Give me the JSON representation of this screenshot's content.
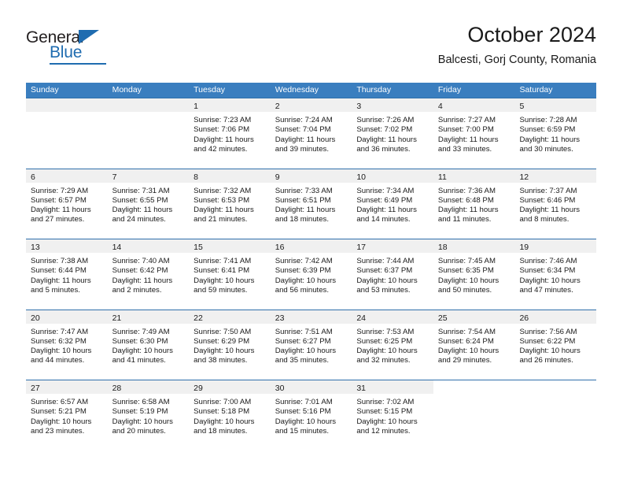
{
  "brand": {
    "name_part1": "General",
    "name_part2": "Blue",
    "accent_color": "#1f6cb0"
  },
  "header": {
    "title": "October 2024",
    "subtitle": "Balcesti, Gorj County, Romania"
  },
  "calendar": {
    "header_color": "#3a7ebf",
    "weekdays": [
      "Sunday",
      "Monday",
      "Tuesday",
      "Wednesday",
      "Thursday",
      "Friday",
      "Saturday"
    ],
    "labels": {
      "sunrise": "Sunrise:",
      "sunset": "Sunset:",
      "daylight": "Daylight:"
    },
    "weeks": [
      [
        {
          "day": "",
          "sunrise": "",
          "sunset": "",
          "daylight_line1": "",
          "daylight_line2": ""
        },
        {
          "day": "",
          "sunrise": "",
          "sunset": "",
          "daylight_line1": "",
          "daylight_line2": ""
        },
        {
          "day": "1",
          "sunrise": "Sunrise: 7:23 AM",
          "sunset": "Sunset: 7:06 PM",
          "daylight_line1": "Daylight: 11 hours",
          "daylight_line2": "and 42 minutes."
        },
        {
          "day": "2",
          "sunrise": "Sunrise: 7:24 AM",
          "sunset": "Sunset: 7:04 PM",
          "daylight_line1": "Daylight: 11 hours",
          "daylight_line2": "and 39 minutes."
        },
        {
          "day": "3",
          "sunrise": "Sunrise: 7:26 AM",
          "sunset": "Sunset: 7:02 PM",
          "daylight_line1": "Daylight: 11 hours",
          "daylight_line2": "and 36 minutes."
        },
        {
          "day": "4",
          "sunrise": "Sunrise: 7:27 AM",
          "sunset": "Sunset: 7:00 PM",
          "daylight_line1": "Daylight: 11 hours",
          "daylight_line2": "and 33 minutes."
        },
        {
          "day": "5",
          "sunrise": "Sunrise: 7:28 AM",
          "sunset": "Sunset: 6:59 PM",
          "daylight_line1": "Daylight: 11 hours",
          "daylight_line2": "and 30 minutes."
        }
      ],
      [
        {
          "day": "6",
          "sunrise": "Sunrise: 7:29 AM",
          "sunset": "Sunset: 6:57 PM",
          "daylight_line1": "Daylight: 11 hours",
          "daylight_line2": "and 27 minutes."
        },
        {
          "day": "7",
          "sunrise": "Sunrise: 7:31 AM",
          "sunset": "Sunset: 6:55 PM",
          "daylight_line1": "Daylight: 11 hours",
          "daylight_line2": "and 24 minutes."
        },
        {
          "day": "8",
          "sunrise": "Sunrise: 7:32 AM",
          "sunset": "Sunset: 6:53 PM",
          "daylight_line1": "Daylight: 11 hours",
          "daylight_line2": "and 21 minutes."
        },
        {
          "day": "9",
          "sunrise": "Sunrise: 7:33 AM",
          "sunset": "Sunset: 6:51 PM",
          "daylight_line1": "Daylight: 11 hours",
          "daylight_line2": "and 18 minutes."
        },
        {
          "day": "10",
          "sunrise": "Sunrise: 7:34 AM",
          "sunset": "Sunset: 6:49 PM",
          "daylight_line1": "Daylight: 11 hours",
          "daylight_line2": "and 14 minutes."
        },
        {
          "day": "11",
          "sunrise": "Sunrise: 7:36 AM",
          "sunset": "Sunset: 6:48 PM",
          "daylight_line1": "Daylight: 11 hours",
          "daylight_line2": "and 11 minutes."
        },
        {
          "day": "12",
          "sunrise": "Sunrise: 7:37 AM",
          "sunset": "Sunset: 6:46 PM",
          "daylight_line1": "Daylight: 11 hours",
          "daylight_line2": "and 8 minutes."
        }
      ],
      [
        {
          "day": "13",
          "sunrise": "Sunrise: 7:38 AM",
          "sunset": "Sunset: 6:44 PM",
          "daylight_line1": "Daylight: 11 hours",
          "daylight_line2": "and 5 minutes."
        },
        {
          "day": "14",
          "sunrise": "Sunrise: 7:40 AM",
          "sunset": "Sunset: 6:42 PM",
          "daylight_line1": "Daylight: 11 hours",
          "daylight_line2": "and 2 minutes."
        },
        {
          "day": "15",
          "sunrise": "Sunrise: 7:41 AM",
          "sunset": "Sunset: 6:41 PM",
          "daylight_line1": "Daylight: 10 hours",
          "daylight_line2": "and 59 minutes."
        },
        {
          "day": "16",
          "sunrise": "Sunrise: 7:42 AM",
          "sunset": "Sunset: 6:39 PM",
          "daylight_line1": "Daylight: 10 hours",
          "daylight_line2": "and 56 minutes."
        },
        {
          "day": "17",
          "sunrise": "Sunrise: 7:44 AM",
          "sunset": "Sunset: 6:37 PM",
          "daylight_line1": "Daylight: 10 hours",
          "daylight_line2": "and 53 minutes."
        },
        {
          "day": "18",
          "sunrise": "Sunrise: 7:45 AM",
          "sunset": "Sunset: 6:35 PM",
          "daylight_line1": "Daylight: 10 hours",
          "daylight_line2": "and 50 minutes."
        },
        {
          "day": "19",
          "sunrise": "Sunrise: 7:46 AM",
          "sunset": "Sunset: 6:34 PM",
          "daylight_line1": "Daylight: 10 hours",
          "daylight_line2": "and 47 minutes."
        }
      ],
      [
        {
          "day": "20",
          "sunrise": "Sunrise: 7:47 AM",
          "sunset": "Sunset: 6:32 PM",
          "daylight_line1": "Daylight: 10 hours",
          "daylight_line2": "and 44 minutes."
        },
        {
          "day": "21",
          "sunrise": "Sunrise: 7:49 AM",
          "sunset": "Sunset: 6:30 PM",
          "daylight_line1": "Daylight: 10 hours",
          "daylight_line2": "and 41 minutes."
        },
        {
          "day": "22",
          "sunrise": "Sunrise: 7:50 AM",
          "sunset": "Sunset: 6:29 PM",
          "daylight_line1": "Daylight: 10 hours",
          "daylight_line2": "and 38 minutes."
        },
        {
          "day": "23",
          "sunrise": "Sunrise: 7:51 AM",
          "sunset": "Sunset: 6:27 PM",
          "daylight_line1": "Daylight: 10 hours",
          "daylight_line2": "and 35 minutes."
        },
        {
          "day": "24",
          "sunrise": "Sunrise: 7:53 AM",
          "sunset": "Sunset: 6:25 PM",
          "daylight_line1": "Daylight: 10 hours",
          "daylight_line2": "and 32 minutes."
        },
        {
          "day": "25",
          "sunrise": "Sunrise: 7:54 AM",
          "sunset": "Sunset: 6:24 PM",
          "daylight_line1": "Daylight: 10 hours",
          "daylight_line2": "and 29 minutes."
        },
        {
          "day": "26",
          "sunrise": "Sunrise: 7:56 AM",
          "sunset": "Sunset: 6:22 PM",
          "daylight_line1": "Daylight: 10 hours",
          "daylight_line2": "and 26 minutes."
        }
      ],
      [
        {
          "day": "27",
          "sunrise": "Sunrise: 6:57 AM",
          "sunset": "Sunset: 5:21 PM",
          "daylight_line1": "Daylight: 10 hours",
          "daylight_line2": "and 23 minutes."
        },
        {
          "day": "28",
          "sunrise": "Sunrise: 6:58 AM",
          "sunset": "Sunset: 5:19 PM",
          "daylight_line1": "Daylight: 10 hours",
          "daylight_line2": "and 20 minutes."
        },
        {
          "day": "29",
          "sunrise": "Sunrise: 7:00 AM",
          "sunset": "Sunset: 5:18 PM",
          "daylight_line1": "Daylight: 10 hours",
          "daylight_line2": "and 18 minutes."
        },
        {
          "day": "30",
          "sunrise": "Sunrise: 7:01 AM",
          "sunset": "Sunset: 5:16 PM",
          "daylight_line1": "Daylight: 10 hours",
          "daylight_line2": "and 15 minutes."
        },
        {
          "day": "31",
          "sunrise": "Sunrise: 7:02 AM",
          "sunset": "Sunset: 5:15 PM",
          "daylight_line1": "Daylight: 10 hours",
          "daylight_line2": "and 12 minutes."
        },
        {
          "day": "",
          "sunrise": "",
          "sunset": "",
          "daylight_line1": "",
          "daylight_line2": ""
        },
        {
          "day": "",
          "sunrise": "",
          "sunset": "",
          "daylight_line1": "",
          "daylight_line2": ""
        }
      ]
    ]
  }
}
